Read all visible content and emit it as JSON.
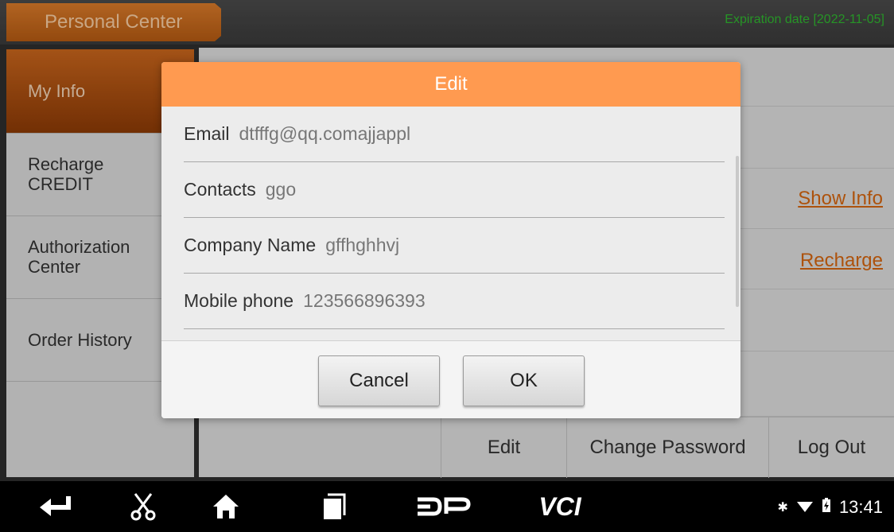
{
  "header": {
    "title": "Personal Center",
    "expiration": "Expiration date [2022-11-05]"
  },
  "sidebar": {
    "items": [
      {
        "label": "My Info",
        "active": true
      },
      {
        "label": "Recharge CREDIT"
      },
      {
        "label": "Authorization Center"
      },
      {
        "label": "Order History"
      }
    ]
  },
  "content": {
    "show_info_link": "Show Info",
    "recharge_link": "Recharge"
  },
  "actions": {
    "edit": "Edit",
    "change_password": "Change Password",
    "log_out": "Log Out"
  },
  "dialog": {
    "title": "Edit",
    "fields": [
      {
        "label": "Email",
        "value": "dtfffg@qq.comajjappl"
      },
      {
        "label": "Contacts",
        "value": "ggo"
      },
      {
        "label": "Company Name",
        "value": "gffhghhvj"
      },
      {
        "label": "Mobile phone",
        "value": "123566896393"
      }
    ],
    "cancel": "Cancel",
    "ok": "OK"
  },
  "navbar": {
    "vci_label": "VCI",
    "dp_label": "DP",
    "time": "13:41"
  },
  "colors": {
    "accent_orange": "#ff9a50",
    "tab_orange": "#c8651c",
    "link_orange": "#d4650f",
    "expiry_green": "#2fb52f"
  }
}
